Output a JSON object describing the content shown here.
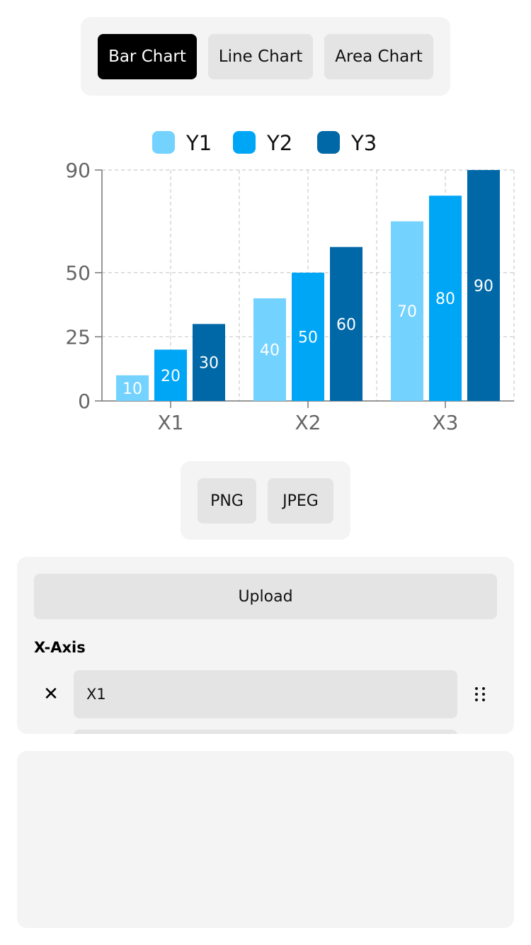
{
  "chart_type_buttons": [
    {
      "label": "Bar Chart",
      "active": true
    },
    {
      "label": "Line Chart",
      "active": false
    },
    {
      "label": "Area Chart",
      "active": false
    }
  ],
  "chart_data": {
    "type": "bar",
    "categories": [
      "X1",
      "X2",
      "X3"
    ],
    "series": [
      {
        "name": "Y1",
        "color": "#74d2fe",
        "values": [
          10,
          40,
          70
        ]
      },
      {
        "name": "Y2",
        "color": "#00a6f6",
        "values": [
          20,
          50,
          80
        ]
      },
      {
        "name": "Y3",
        "color": "#0068a7",
        "values": [
          30,
          60,
          90
        ]
      }
    ],
    "yticks": [
      0,
      25,
      50,
      90
    ],
    "ylim": [
      0,
      90
    ],
    "grid": true,
    "legend_position": "top-center",
    "data_labels": true
  },
  "export": {
    "png_label": "PNG",
    "jpeg_label": "JPEG"
  },
  "editor": {
    "upload_label": "Upload",
    "section_title": "X-Axis",
    "rows": [
      {
        "value": "X1"
      },
      {
        "value": ""
      }
    ]
  }
}
